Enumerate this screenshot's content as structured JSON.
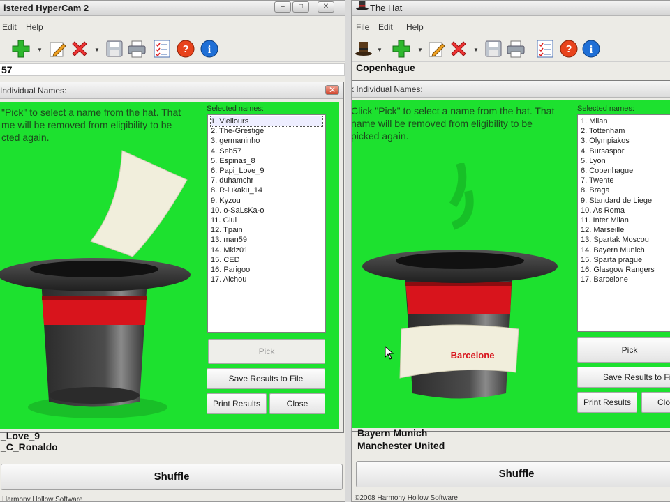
{
  "left_window": {
    "title": "istered HyperCam 2",
    "menu": [
      "Edit",
      "Help"
    ],
    "top_field": "57",
    "dialog": {
      "title": "Individual Names:",
      "instructions": "\"Pick\" to select a name from the hat. That me will be removed from eligibility to be cted again.",
      "instructions_lines": [
        "\"Pick\" to select a name from the hat. That",
        "me will be removed from eligibility to be",
        "cted again."
      ],
      "selected_label": "Selected names:",
      "selected_names": [
        "1. Vieilours",
        "2. The-Grestige",
        "3. germaninho",
        "4. Seb57",
        "5. Espinas_8",
        "6. Papi_Love_9",
        "7. duhamchr",
        "8. R-lukaku_14",
        "9. Kyzou",
        "10. o-SaLsKa-o",
        "11. Giul",
        "12. Tpain",
        "13. man59",
        "14. Mklz01",
        "15. CED",
        "16. Parigool",
        "17. Alchou"
      ],
      "pick_label": "Pick",
      "save_label": "Save Results to File",
      "print_label": "Print Results",
      "close_label": "Close"
    },
    "bottom_lines": [
      "_Love_9",
      "_C_Ronaldo"
    ],
    "shuffle_label": "Shuffle",
    "footer": "Harmony Hollow Software"
  },
  "right_window": {
    "title": "The Hat",
    "menu": [
      "File",
      "Edit",
      "Help"
    ],
    "top_field_1": "Copenhague",
    "dialog": {
      "title": "ck Individual Names:",
      "instructions_lines": [
        "Click \"Pick\" to select a name from the hat. That",
        "name will be removed from eligibility to be",
        "picked again."
      ],
      "selected_label": "Selected names:",
      "selected_names": [
        "1. Milan",
        "2. Tottenham",
        "3. Olympiakos",
        "4. Bursaspor",
        "5. Lyon",
        "6. Copenhague",
        "7. Twente",
        "8. Braga",
        "9. Standard de Liege",
        "10. As Roma",
        "11. Inter Milan",
        "12. Marseille",
        "13. Spartak Moscou",
        "14. Bayern Munich",
        "15. Sparta prague",
        "16. Glasgow Rangers",
        "17. Barcelone"
      ],
      "paper_label": "Barcelone",
      "pick_label": "Pick",
      "save_label": "Save Results to File",
      "print_label": "Print Results",
      "close_label": "Clo"
    },
    "bottom_lines": [
      "Bayern Munich",
      "Manchester United"
    ],
    "shuffle_label": "Shuffle",
    "footer": "©2008 Harmony Hollow Software"
  },
  "colors": {
    "green_panel": "#1de12f",
    "hat_band": "#d8141c",
    "hat_body": "#3a3a3a",
    "paper": "#f1eedc",
    "paper_text": "#d8141c"
  },
  "icons": [
    "hat-icon",
    "add-icon",
    "edit-icon",
    "delete-icon",
    "save-icon",
    "print-icon",
    "checklist-icon",
    "help-icon",
    "info-icon"
  ]
}
